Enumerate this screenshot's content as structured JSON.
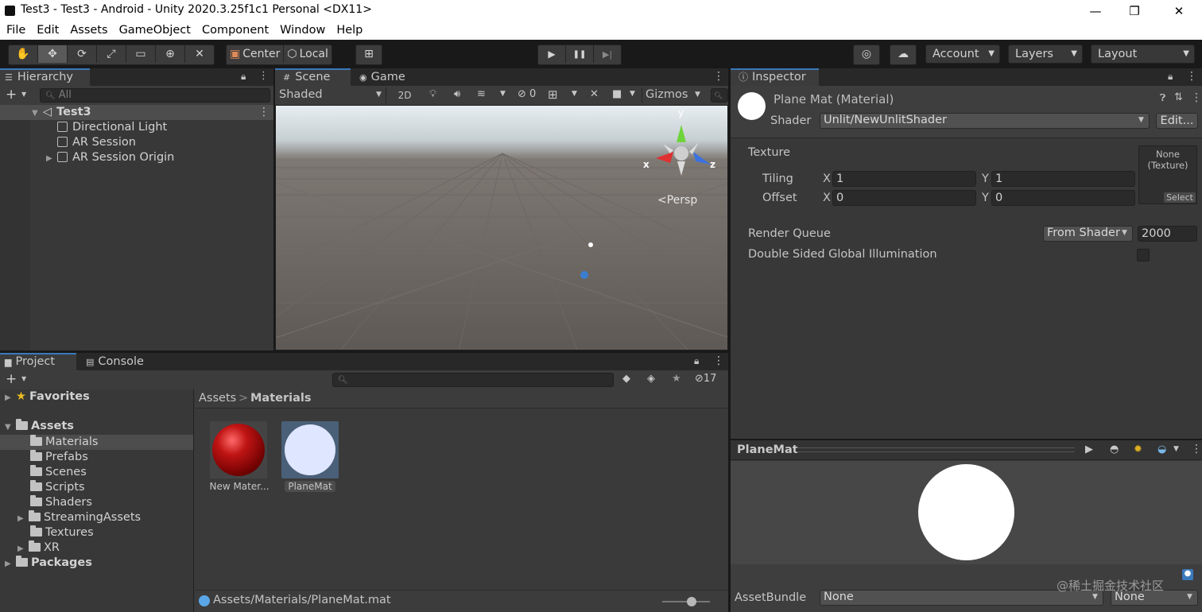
{
  "window": {
    "title": "Test3 - Test3 - Android - Unity 2020.3.25f1c1 Personal <DX11>",
    "minimize": "—",
    "maximize": "❐",
    "close": "✕"
  },
  "menu": [
    "File",
    "Edit",
    "Assets",
    "GameObject",
    "Component",
    "Window",
    "Help"
  ],
  "toolbar": {
    "tools": [
      "hand-icon",
      "move-icon",
      "rotate-icon",
      "scale-icon",
      "rect-icon",
      "transform-icon",
      "custom-tool-icon"
    ],
    "pivot": "Center",
    "space": "Local",
    "play": "▶",
    "pause": "❚❚",
    "step": "▶|",
    "account": "Account",
    "layers": "Layers",
    "layout": "Layout"
  },
  "hierarchy": {
    "tab": "Hierarchy",
    "search_placeholder": "All",
    "scene": "Test3",
    "items": [
      "Directional Light",
      "AR Session",
      "AR Session Origin"
    ]
  },
  "scene_view": {
    "tab_scene": "Scene",
    "tab_game": "Game",
    "shading": "Shaded",
    "mode_2d": "2D",
    "hidden_count": "0",
    "gizmos": "Gizmos",
    "persp": "Persp",
    "axis_x": "x",
    "axis_y": "y",
    "axis_z": "z"
  },
  "inspector": {
    "tab": "Inspector",
    "material_name": "Plane Mat (Material)",
    "shader_label": "Shader",
    "shader_value": "Unlit/NewUnlitShader",
    "edit_button": "Edit...",
    "texture_label": "Texture",
    "tiling_label": "Tiling",
    "offset_label": "Offset",
    "x_label": "X",
    "y_label": "Y",
    "tiling_x": "1",
    "tiling_y": "1",
    "offset_x": "0",
    "offset_y": "0",
    "texture_none_line1": "None",
    "texture_none_line2": "(Texture)",
    "texture_select": "Select",
    "render_queue_label": "Render Queue",
    "render_queue_mode": "From Shader",
    "render_queue_value": "2000",
    "double_sided_label": "Double Sided Global Illumination",
    "preview_title": "PlaneMat",
    "assetbundle_label": "AssetBundle",
    "assetbundle_value": "None",
    "assetbundle_variant": "None"
  },
  "project": {
    "tab_project": "Project",
    "tab_console": "Console",
    "hidden_count": "17",
    "favorites": "Favorites",
    "assets": "Assets",
    "folders": [
      "Materials",
      "Prefabs",
      "Scenes",
      "Scripts",
      "Shaders",
      "StreamingAssets",
      "Textures",
      "XR"
    ],
    "packages": "Packages",
    "breadcrumb_root": "Assets",
    "breadcrumb_sep": ">",
    "breadcrumb_current": "Materials",
    "grid_items": [
      "New Mater...",
      "PlaneMat"
    ],
    "status_path": "Assets/Materials/PlaneMat.mat"
  },
  "watermark": "@稀土掘金技术社区",
  "colors": {
    "accent_blue": "#3a79bb",
    "selection": "#4d4d4d",
    "red_sphere": "#b01010",
    "planemat_sphere": "#dfe6ff",
    "scene_ground": "#615c58",
    "scene_sky": "#c9d4dc"
  }
}
